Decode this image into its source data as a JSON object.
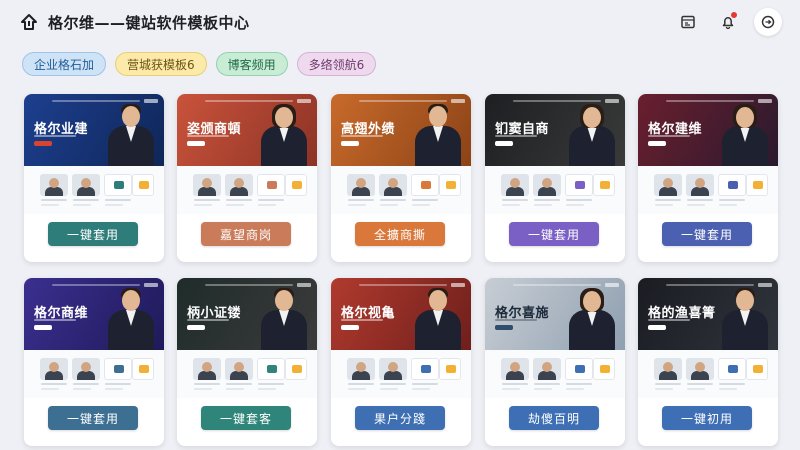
{
  "header": {
    "title": "格尔维——键站软件模板中心",
    "icons": [
      "home-upload-icon",
      "calendar-icon",
      "bell-icon",
      "chat-icon"
    ]
  },
  "chips": [
    {
      "label": "企业格石加"
    },
    {
      "label": "营城获模板6"
    },
    {
      "label": "博客频用"
    },
    {
      "label": "多络领航6"
    }
  ],
  "cards": [
    {
      "hero_title": "格尔业建",
      "button": "一键套用",
      "theme": "#1d3f8f",
      "theme2": "#0f2658",
      "accent": "#d8452f",
      "btn_color": "#2f7d7a",
      "person": "m"
    },
    {
      "hero_title": "姿颁商頓",
      "button": "嘉望商岗",
      "theme": "#c9533b",
      "theme2": "#8d3326",
      "accent": "#ffffff",
      "btn_color": "#c97b5a",
      "person": "f"
    },
    {
      "hero_title": "高翅外缋",
      "button": "全擴商撕",
      "theme": "#c86a2b",
      "theme2": "#8c4317",
      "accent": "#ffffff",
      "btn_color": "#d9783a",
      "person": "m"
    },
    {
      "hero_title": "钔窦自商",
      "button": "一键套用",
      "theme": "#1d1f22",
      "theme2": "#3a3a3a",
      "accent": "#ffffff",
      "btn_color": "#7a5fc4",
      "person": "f"
    },
    {
      "hero_title": "格尔建维",
      "button": "一键套用",
      "theme": "#6a1f2e",
      "theme2": "#2a1a2e",
      "accent": "#ffffff",
      "btn_color": "#4b60b0",
      "person": "f"
    },
    {
      "hero_title": "格尔商维",
      "button": "一键套用",
      "theme": "#3b2f8f",
      "theme2": "#1f1a5a",
      "accent": "#ffffff",
      "btn_color": "#3d6f93",
      "person": "m"
    },
    {
      "hero_title": "柄小证镂",
      "button": "一键套客",
      "theme": "#1f2c2a",
      "theme2": "#3b3b3b",
      "accent": "#ffffff",
      "btn_color": "#2f857a",
      "person": "m"
    },
    {
      "hero_title": "格尔视亀",
      "button": "果户分踐",
      "theme": "#b03a2e",
      "theme2": "#6f1f1c",
      "accent": "#ffffff",
      "btn_color": "#3f6fb3",
      "person": "m"
    },
    {
      "hero_title": "格尔喜施",
      "button": "劫傻百明",
      "theme": "#c8cdd4",
      "theme2": "#8fa0b0",
      "accent": "#2f4d6f",
      "btn_color": "#3e6fb5",
      "person": "f"
    },
    {
      "hero_title": "格的渔喜箐",
      "button": "一键初用",
      "theme": "#1a1c22",
      "theme2": "#30343c",
      "accent": "#ffffff",
      "btn_color": "#3e6fb5",
      "person": "m"
    }
  ]
}
